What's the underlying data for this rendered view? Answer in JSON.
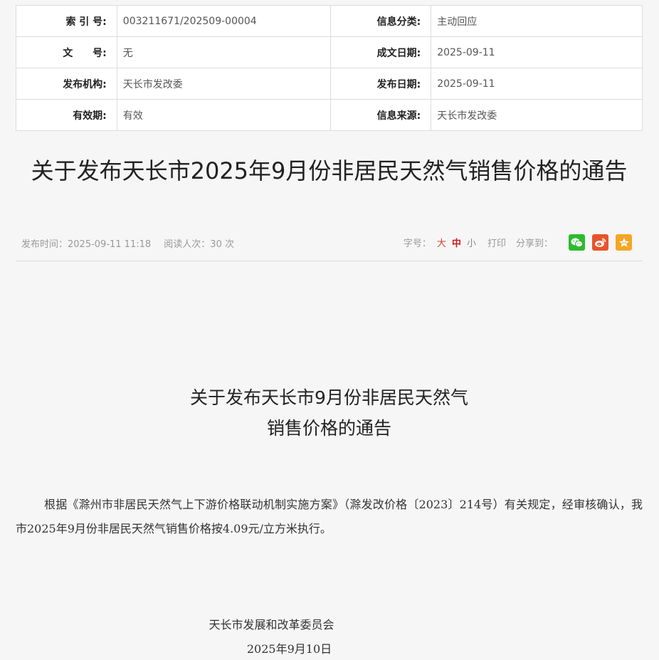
{
  "meta": {
    "rows": [
      {
        "l1": "索 引 号:",
        "v1": "003211671/202509-00004",
        "l2": "信息分类:",
        "v2": "主动回应"
      },
      {
        "l1": "文　　号:",
        "v1": "无",
        "l2": "成文日期:",
        "v2": "2025-09-11"
      },
      {
        "l1": "发布机构:",
        "v1": "天长市发改委",
        "l2": "发布日期:",
        "v2": "2025-09-11"
      },
      {
        "l1": "有效期:",
        "v1": "有效",
        "l2": "信息来源:",
        "v2": "天长市发改委"
      }
    ]
  },
  "article": {
    "title": "关于发布天长市2025年9月份非居民天然气销售价格的通告",
    "publish_time": "发布时间：2025-09-11 11:18",
    "read_count": "阅读人次：30 次",
    "font_size_label": "字号：",
    "font_big": "大",
    "font_mid": "中",
    "font_small": "小",
    "print": "打印",
    "share_label": "分享到：",
    "subtitle_line1": "关于发布天长市9月份非居民天然气",
    "subtitle_line2": "销售价格的通告",
    "body": "根据《滁州市非居民天然气上下游价格联动机制实施方案》（滁发改价格〔2023〕214号）有关规定，经审核确认，我市2025年9月份非居民天然气销售价格按4.09元/立方米执行。",
    "signer": "天长市发展和改革委员会",
    "date": "2025年9月10日"
  },
  "share_icons": [
    {
      "name": "wechat-icon",
      "color": "#2dbb2d"
    },
    {
      "name": "weibo-icon",
      "color": "#e8532b"
    },
    {
      "name": "qzone-icon",
      "color": "#f5a623"
    }
  ]
}
